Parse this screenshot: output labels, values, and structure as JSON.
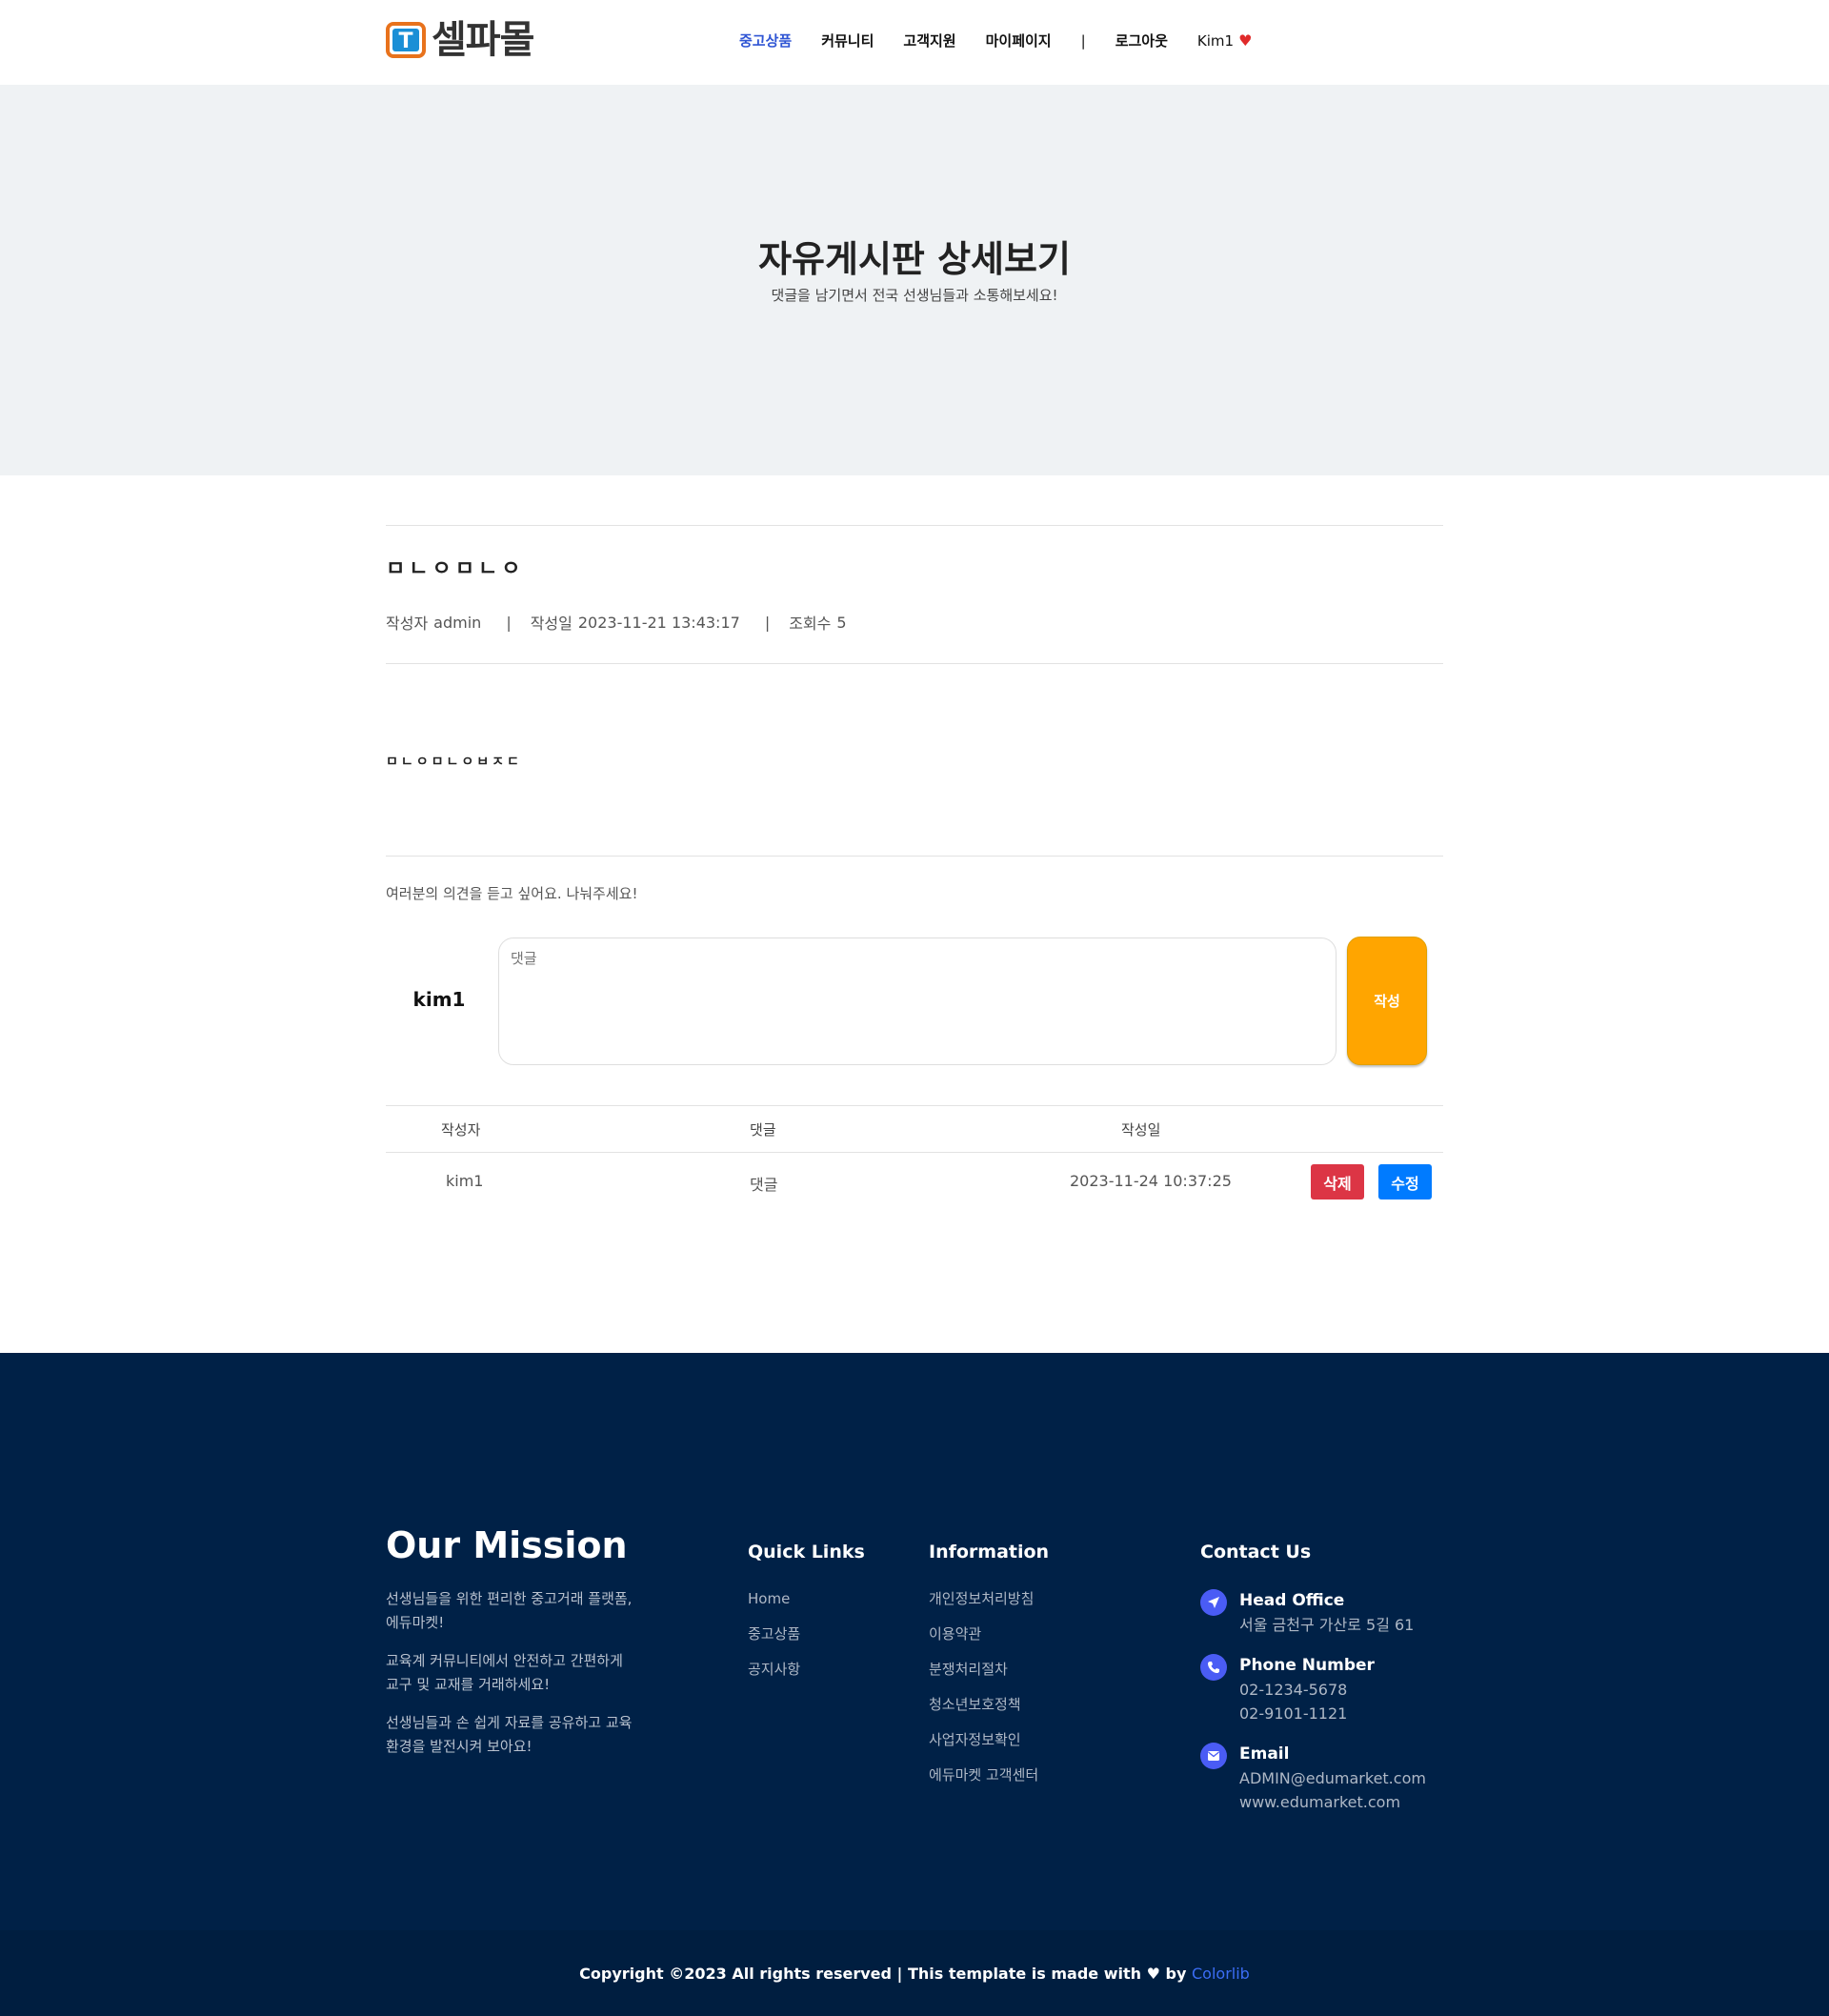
{
  "brand": {
    "name": "셀파몰",
    "mark_letter": "T",
    "mark_color": "#e8721c",
    "mark_inner": "#1a8fd6"
  },
  "nav": {
    "items": [
      "중고상품",
      "커뮤니티",
      "고객지원",
      "마이페이지"
    ],
    "separator": "|",
    "logout": "로그아웃",
    "user": "Kim1",
    "active_color": "#2f55d4"
  },
  "hero": {
    "title": "자유게시판 상세보기",
    "subtitle": "댓글을 남기면서 전국 선생님들과 소통해보세요!"
  },
  "post": {
    "title": "ㅁㄴㅇㅁㄴㅇ",
    "author_label": "작성자",
    "author": "admin",
    "date_label": "작성일",
    "date": "2023-11-21 13:43:17",
    "views_label": "조회수",
    "views": "5",
    "body": "ㅁㄴㅇㅁㄴㅇㅂㅈㄷ"
  },
  "comment_form": {
    "prompt": "여러분의 의견을 듣고 싶어요. 나눠주세요!",
    "user": "kim1",
    "placeholder": "댓글",
    "submit": "작성"
  },
  "comments": {
    "headers": [
      "작성자",
      "댓글",
      "작성일"
    ],
    "rows": [
      {
        "author": "kim1",
        "text": "댓글",
        "date": "2023-11-24 10:37:25"
      }
    ],
    "delete_label": "삭제",
    "edit_label": "수정"
  },
  "footer": {
    "mission_title": "Our Mission",
    "mission_lines": [
      "선생님들을 위한 편리한 중고거래 플랫폼, 에듀마켓!",
      "교육계 커뮤니티에서 안전하고 간편하게 교구 및 교재를 거래하세요!",
      "선생님들과 손 쉽게 자료를 공유하고 교육 환경을 발전시켜 보아요!"
    ],
    "quick_links_title": "Quick Links",
    "quick_links": [
      "Home",
      "중고상품",
      "공지사항"
    ],
    "information_title": "Information",
    "information": [
      "개인정보처리방침",
      "이용약관",
      "분쟁처리절차",
      "청소년보호정책",
      "사업자정보확인",
      "에듀마켓 고객센터"
    ],
    "contact_title": "Contact Us",
    "head_office_label": "Head Office",
    "head_office": "서울 금천구 가산로 5길 61",
    "phone_label": "Phone Number",
    "phones": [
      "02-1234-5678",
      "02-9101-1121"
    ],
    "email_label": "Email",
    "email": "ADMIN@edumarket.com",
    "website": "www.edumarket.com",
    "copyright": "Copyright ©2023 All rights reserved | This template is made with",
    "copyright_by": "by",
    "copyright_link": "Colorlib"
  }
}
